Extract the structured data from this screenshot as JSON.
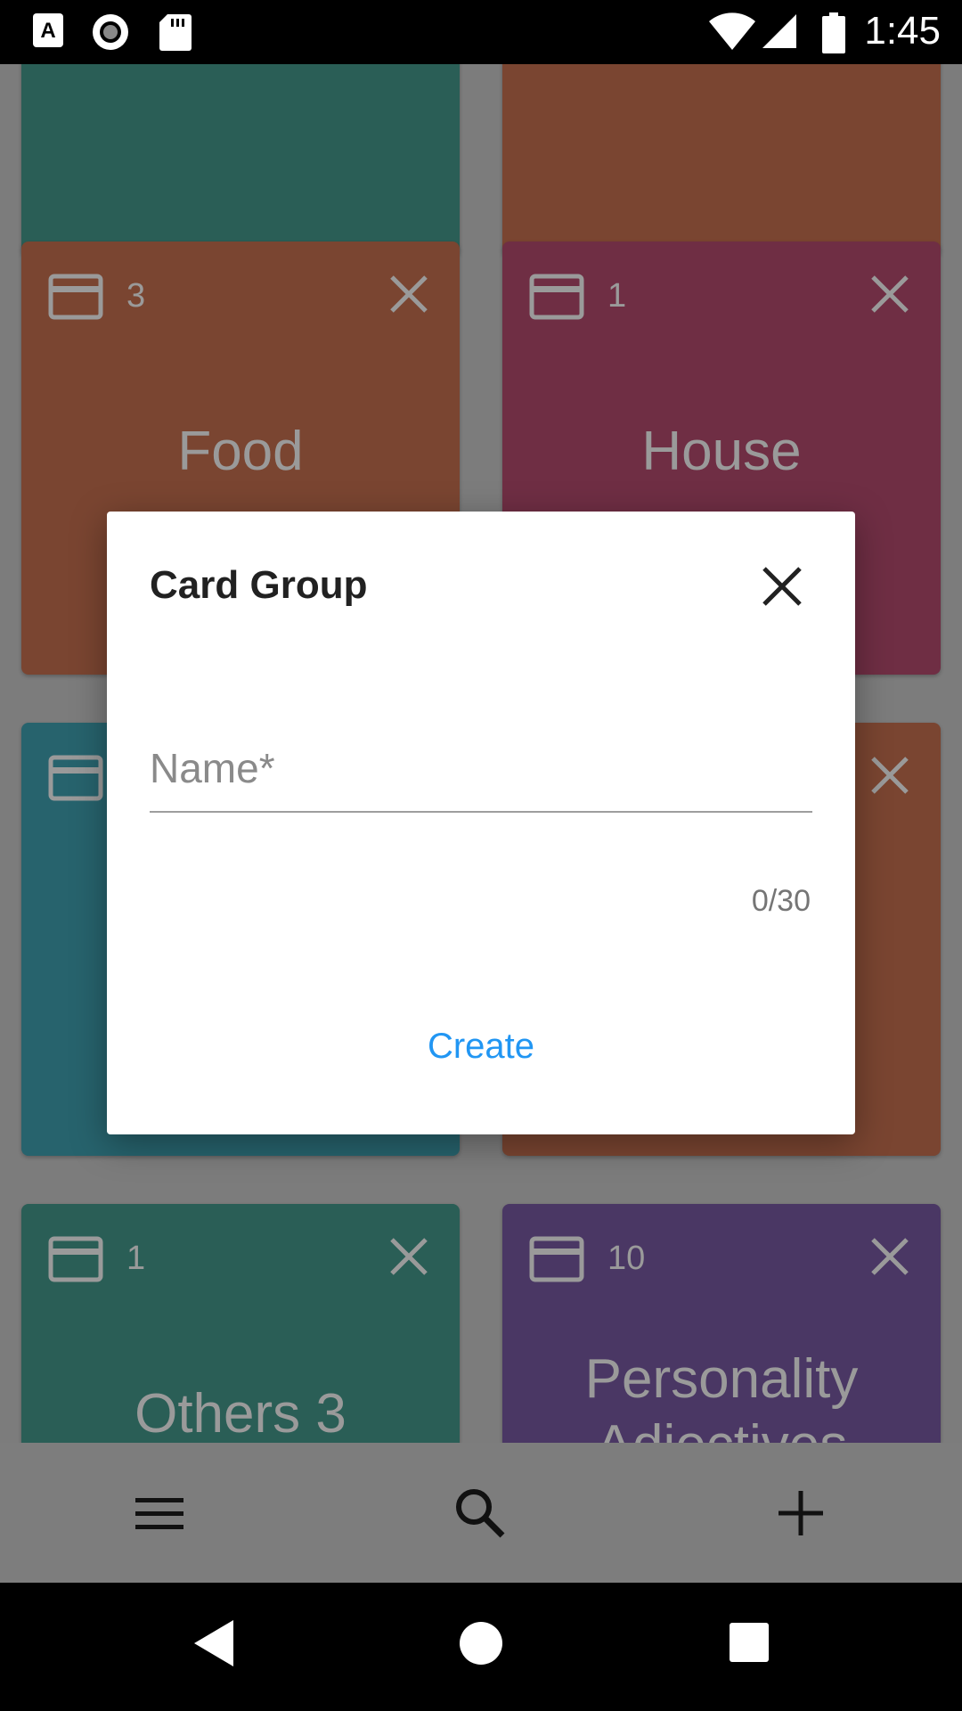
{
  "status_bar": {
    "time": "1:45",
    "icons": [
      "keyboard-a-icon",
      "record-icon",
      "sd-card-icon",
      "wifi-icon",
      "signal-icon",
      "battery-icon"
    ]
  },
  "cards": [
    {
      "count": "",
      "title": "",
      "color": "#2a5e56"
    },
    {
      "count": "",
      "title": "",
      "color": "#7a4531"
    },
    {
      "count": "3",
      "title": "Food",
      "color": "#7a4531"
    },
    {
      "count": "1",
      "title": "House",
      "color": "#6f2e44"
    },
    {
      "count": "",
      "title": "",
      "color": "#27636d"
    },
    {
      "count": "",
      "title": "",
      "color": "#7a4531"
    },
    {
      "count": "1",
      "title": "Others 3",
      "color": "#2a5e56"
    },
    {
      "count": "10",
      "title": "Personality Adjectives",
      "color": "#4a3764"
    }
  ],
  "dialog": {
    "title": "Card Group",
    "name_placeholder": "Name*",
    "name_value": "",
    "counter": "0/30",
    "create_label": "Create"
  },
  "app_bar": {
    "icons": [
      "menu-icon",
      "search-icon",
      "add-icon"
    ]
  },
  "nav_bar": {
    "icons": [
      "back-icon",
      "home-icon",
      "recents-icon"
    ]
  },
  "colors": {
    "accent": "#2196f3",
    "scrim": "#7c7c7c"
  }
}
